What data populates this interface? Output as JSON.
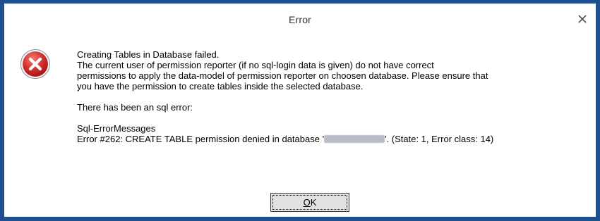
{
  "dialog": {
    "title": "Error",
    "close_icon": "close-icon",
    "icon": "error-circle-x-icon"
  },
  "message": {
    "line1": "Creating Tables in Database failed.",
    "line2": "The current user of permission reporter (if no sql-login data is given) do not have correct",
    "line3": "permissions to apply the data-model of permission reporter on choosen database. Please ensure that",
    "line4": "you have the permission to create tables inside the selected database.",
    "line5": "There has been an sql error:",
    "line6": "Sql-ErrorMessages",
    "line7_prefix": "Error #262: CREATE TABLE permission denied in database '",
    "line7_suffix": "'. (State: 1, Error class: 14)"
  },
  "buttons": {
    "ok_mnemonic": "O",
    "ok_rest": "K"
  },
  "colors": {
    "frame": "#1e4f8f",
    "error_red": "#c8242b"
  }
}
